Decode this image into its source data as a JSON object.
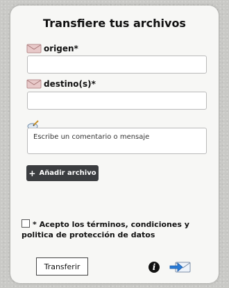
{
  "form": {
    "title": "Transfiere tus archivos",
    "origin_label": "origen*",
    "destination_label": "destino(s)*",
    "comment_placeholder": "Escribe un comentario o mensaje",
    "add_file_label": "Añadir archivo",
    "add_file_icon": "+",
    "terms_text": "* Acepto los términos, condiciones y politica de protección de datos",
    "transfer_label": "Transferir",
    "info_icon_glyph": "i"
  },
  "colors": {
    "page_background": "#c9c9c6",
    "card_background": "#f7f7f5",
    "button_dark": "#3b3d40",
    "send_icon_accent": "#2a7bd6"
  },
  "icons": [
    "envelope-icon",
    "envelope-icon",
    "comment-pencil-icon",
    "plus-icon",
    "info-icon",
    "send-arrow-icon"
  ]
}
